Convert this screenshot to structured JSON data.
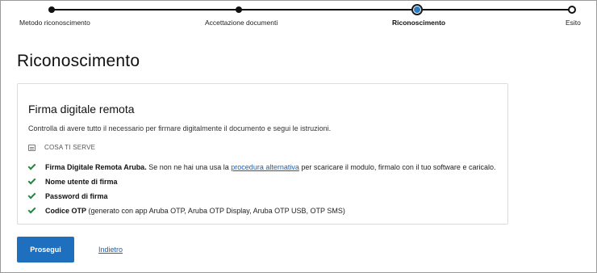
{
  "stepper": {
    "steps": [
      {
        "label": "Metodo riconoscimento",
        "state": "done"
      },
      {
        "label": "Accettazione documenti",
        "state": "done"
      },
      {
        "label": "Riconoscimento",
        "state": "current"
      },
      {
        "label": "Esito",
        "state": "todo"
      }
    ],
    "accent": "#2a7fc4"
  },
  "page": {
    "title": "Riconoscimento"
  },
  "card": {
    "title": "Firma digitale remota",
    "intro": "Controlla di avere tutto il necessario per firmare digitalmente il documento e segui le istruzioni.",
    "needs_icon": "list-icon",
    "needs_label": "COSA TI SERVE",
    "requirements": [
      {
        "bold": "Firma Digitale Remota Aruba.",
        "text_before": " Se non ne hai una usa la ",
        "link": "procedura alternativa",
        "text_after": " per scaricare il modulo, firmalo con il tuo software e caricalo."
      },
      {
        "bold": "Nome utente di firma"
      },
      {
        "bold": "Password di firma"
      },
      {
        "bold": "Codice OTP",
        "text_before": " (generato con app Aruba OTP, Aruba OTP Display, Aruba OTP USB, OTP SMS)"
      }
    ],
    "check_color": "#1f8a3b"
  },
  "actions": {
    "primary_label": "Prosegui",
    "back_label": "Indietro",
    "primary_color": "#1f6fbf"
  }
}
